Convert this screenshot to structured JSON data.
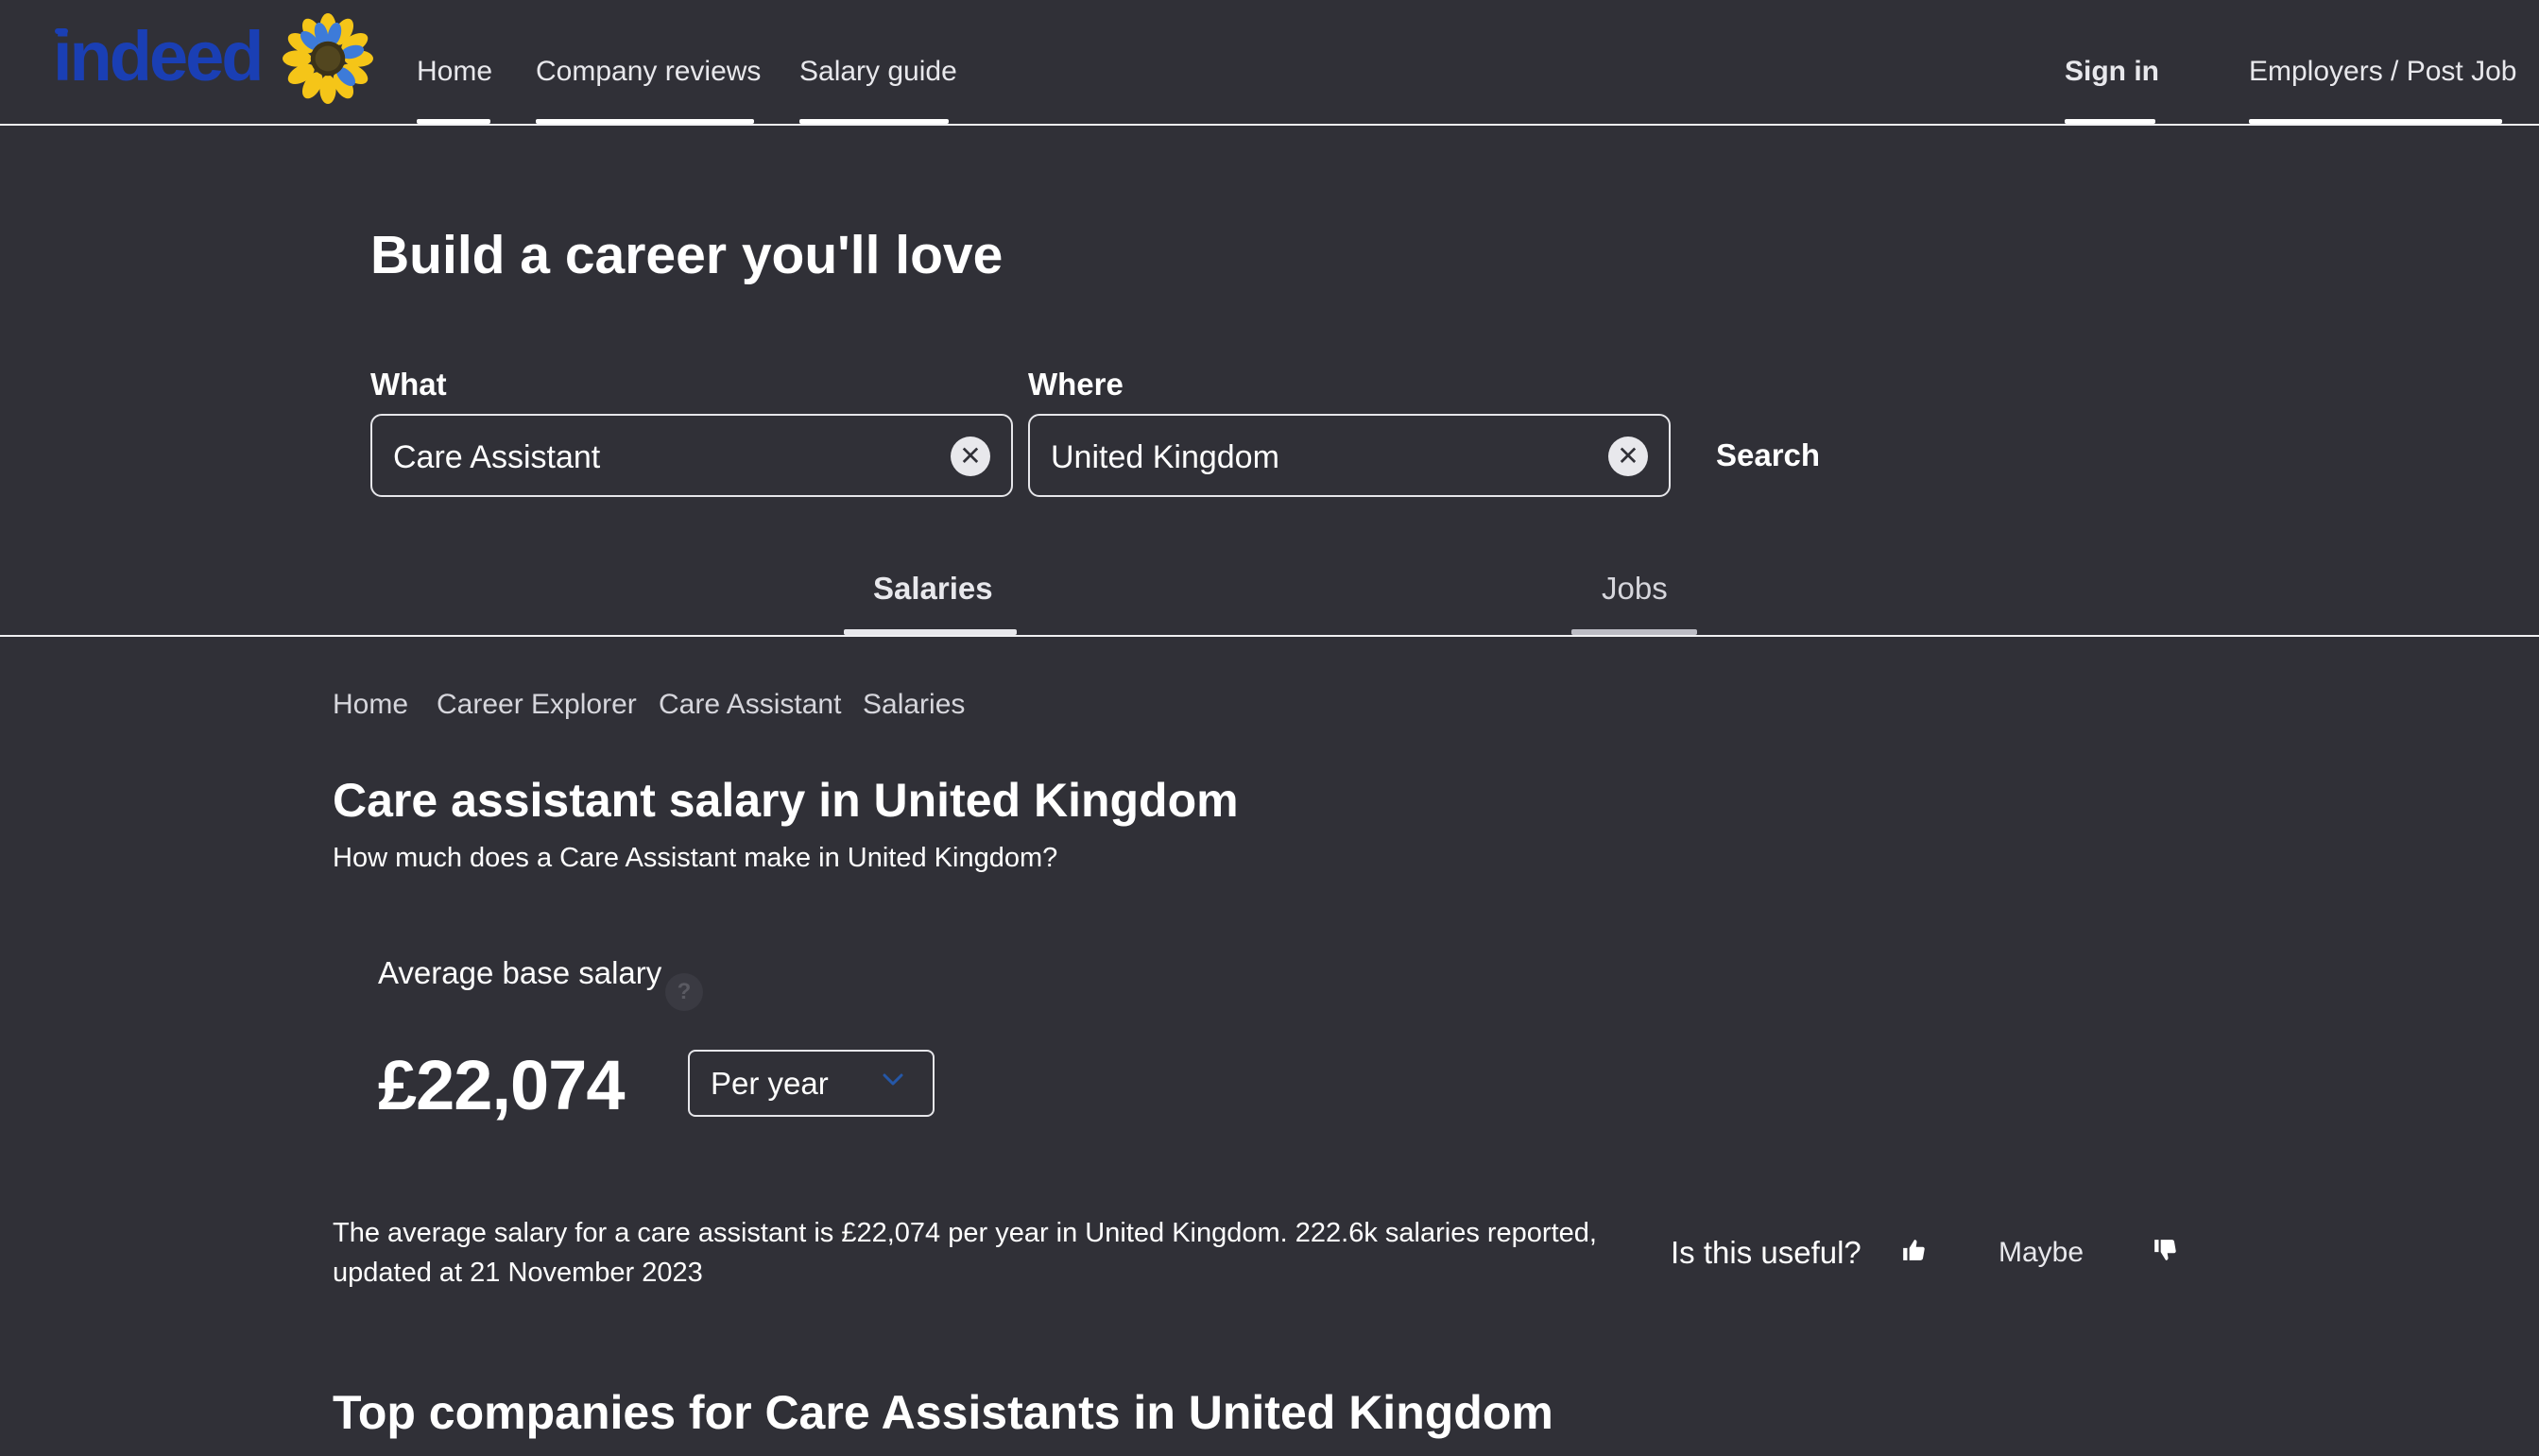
{
  "header": {
    "logo_text": "indeed",
    "nav": [
      {
        "label": "Home"
      },
      {
        "label": "Company reviews"
      },
      {
        "label": "Salary guide"
      }
    ],
    "sign_in": "Sign in",
    "employers": "Employers / Post Job"
  },
  "hero": {
    "title": "Build a career you'll love",
    "what_label": "What",
    "what_value": "Care Assistant",
    "where_label": "Where",
    "where_value": "United Kingdom",
    "search_label": "Search"
  },
  "tabs": [
    {
      "label": "Salaries",
      "active": true
    },
    {
      "label": "Jobs",
      "active": false
    }
  ],
  "breadcrumb": [
    "Home",
    "Career Explorer",
    "Care Assistant",
    "Salaries"
  ],
  "main": {
    "title": "Care assistant salary in United Kingdom",
    "subtitle": "How much does a Care Assistant make in United Kingdom?",
    "avg_label": "Average base salary",
    "help_icon": "?",
    "avg_value": "£22,074",
    "period": "Per year",
    "description": "The average salary for a care assistant is £22,074 per year in United Kingdom.  222.6k salaries reported, updated at 21 November 2023",
    "useful_label": "Is this useful?",
    "maybe_label": "Maybe",
    "top_companies_title": "Top companies for Care Assistants in United Kingdom"
  },
  "colors": {
    "background": "#303037",
    "logo_blue": "#1a3fb4",
    "accent_blue": "#2557a7",
    "text": "#ffffff"
  },
  "icons": [
    "sunflower-icon",
    "clear-icon",
    "chevron-down-icon",
    "help-icon",
    "thumbs-up-icon",
    "thumbs-down-icon"
  ]
}
